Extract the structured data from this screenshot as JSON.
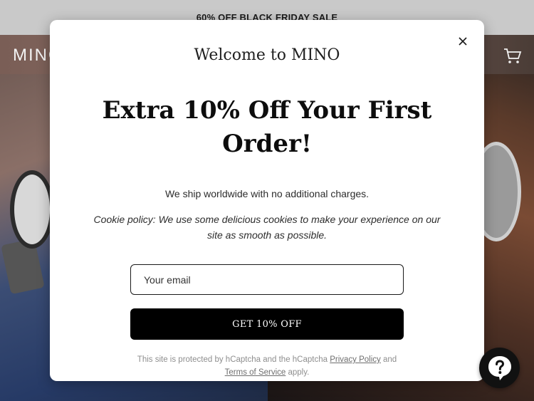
{
  "announcement": {
    "text": "60% OFF BLACK FRIDAY SALE"
  },
  "header": {
    "logo_text": "MINO",
    "cart_icon": "cart-icon"
  },
  "modal": {
    "welcome": "Welcome to MINO",
    "headline": "Extra 10% Off Your First Order!",
    "shipping": "We ship worldwide with no additional charges.",
    "cookie": "Cookie policy: We use some delicious cookies to make your experience on our site as smooth as possible.",
    "email_placeholder": "Your email",
    "cta_label": "GET 10% OFF",
    "legal": {
      "prefix": "This site is protected by hCaptcha and the hCaptcha ",
      "privacy_link": "Privacy Policy",
      "and": " and ",
      "terms_link": "Terms of Service",
      "suffix": " apply."
    },
    "close_icon": "close-icon"
  },
  "chat": {
    "icon": "help-question-icon"
  },
  "colors": {
    "announcement_bg": "#c9c9c9",
    "cta_bg": "#000000",
    "modal_bg": "#ffffff"
  }
}
